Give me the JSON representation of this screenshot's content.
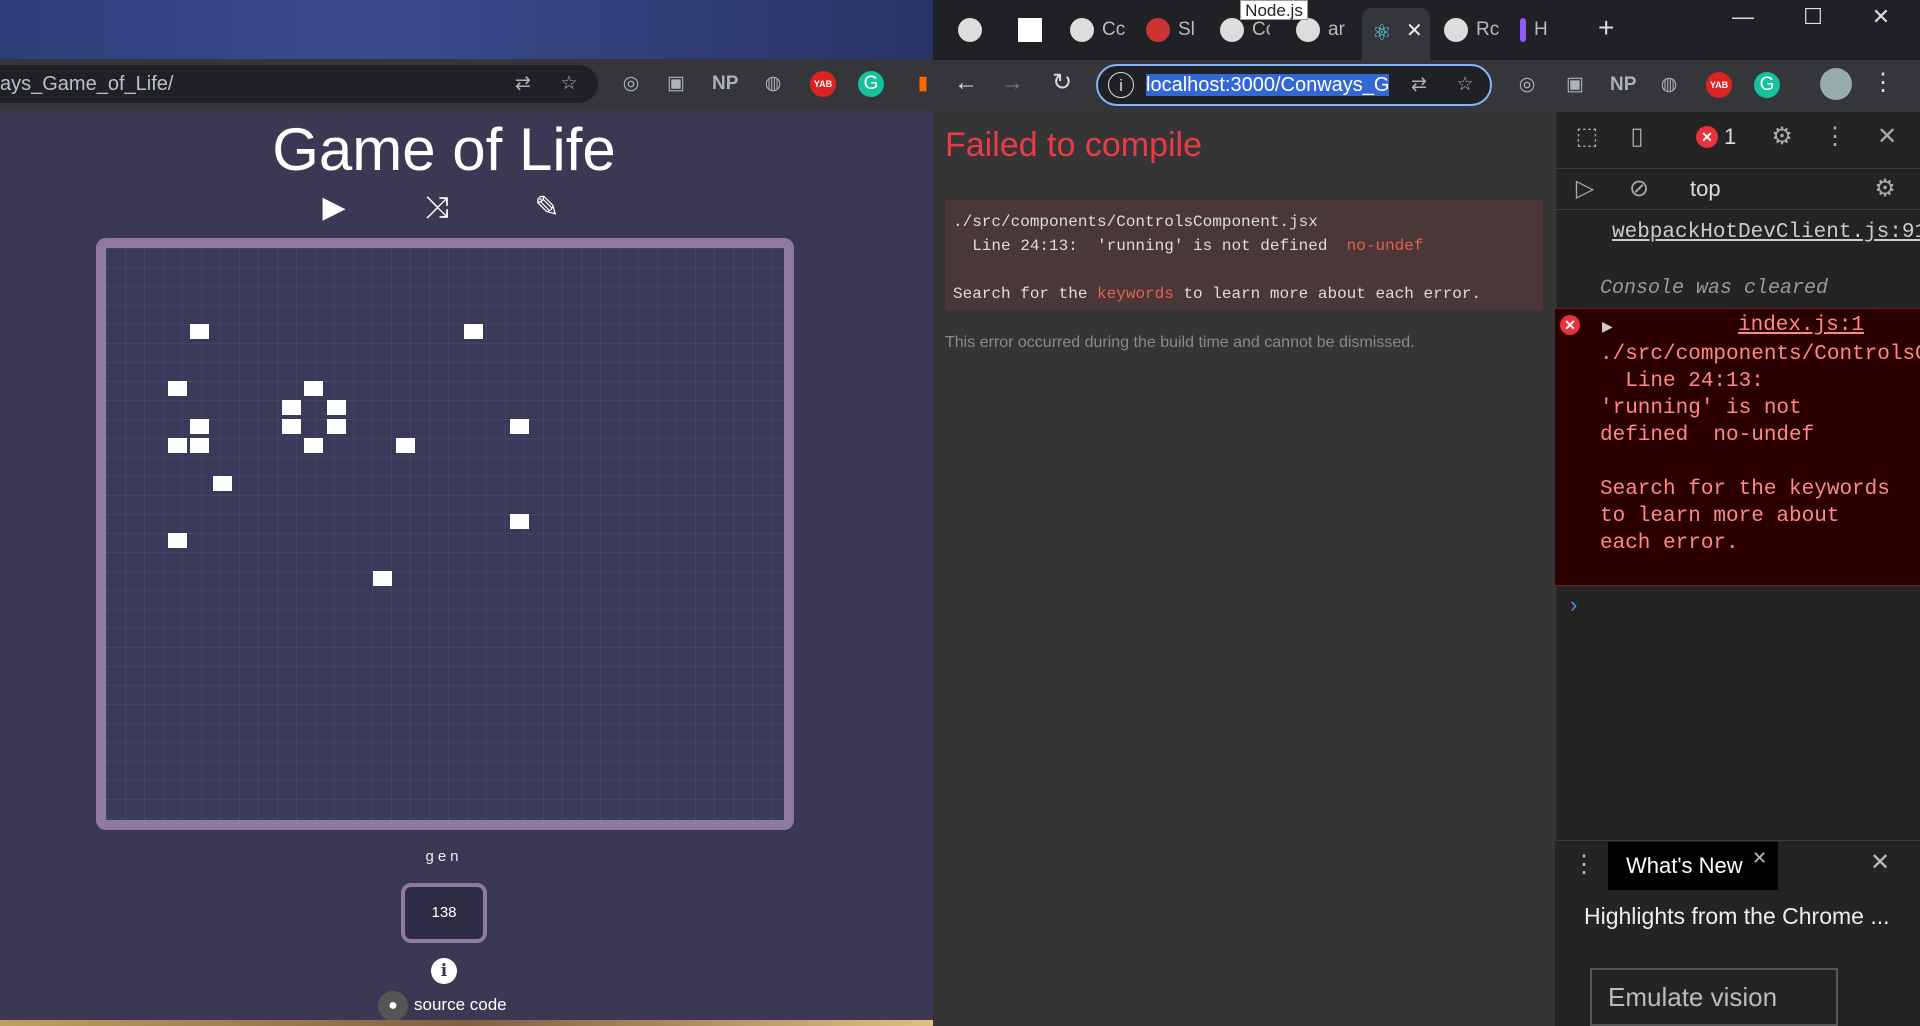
{
  "left_window": {
    "url": "ays_Game_of_Life/",
    "title": "Game of Life",
    "gen_label": "gen",
    "gen_value": "138",
    "source_link": "source code",
    "info_glyph": "i",
    "ext_np": "NP",
    "ext_yab": "YAB"
  },
  "right_window": {
    "tooltip": "Node.js",
    "tabs": [
      "Cc",
      "Sl",
      "Cc",
      "ar",
      "Rc",
      "H"
    ],
    "url_selected": "localhost:3000/Conways_G",
    "ext_np": "NP",
    "ext_yab": "YAB"
  },
  "overlay": {
    "title": "Failed to compile",
    "file": "./src/components/ControlsComponent.jsx",
    "line_text": "  Line 24:13:  'running' is not defined  ",
    "rule": "no-undef",
    "search_pre": "Search for the ",
    "search_kw": "keywords",
    "search_post": " to learn more about each error.",
    "dismiss": "This error occurred during the build time and cannot be dismissed."
  },
  "devtools": {
    "error_count": "1",
    "context": "top",
    "source_link": "webpackHotDevClient.js:91",
    "cleared": "Console was cleared",
    "error_source": "index.js:1",
    "error_text": "./src/components/ControlsComponent.jsx\n  Line 24:13:  'running' is not defined  no-undef\n\nSearch for the keywords to learn more about each error.",
    "drawer_tab": "What's New",
    "highlights": "Highlights from the Chrome ...",
    "emulate": "Emulate vision"
  },
  "colors": {
    "accent": "#8f7aa0",
    "error": "#e83b46",
    "game_bg": "#3b3854"
  },
  "board": {
    "live_cells": [
      [
        3,
        4
      ],
      [
        15,
        4
      ],
      [
        2,
        7
      ],
      [
        8,
        7
      ],
      [
        7,
        8
      ],
      [
        9,
        8
      ],
      [
        3,
        9
      ],
      [
        7,
        9
      ],
      [
        9,
        9
      ],
      [
        2,
        10
      ],
      [
        3,
        10
      ],
      [
        8,
        10
      ],
      [
        12,
        10
      ],
      [
        17,
        9
      ],
      [
        4,
        12
      ],
      [
        2,
        15
      ],
      [
        17,
        14
      ],
      [
        11,
        17
      ]
    ]
  }
}
